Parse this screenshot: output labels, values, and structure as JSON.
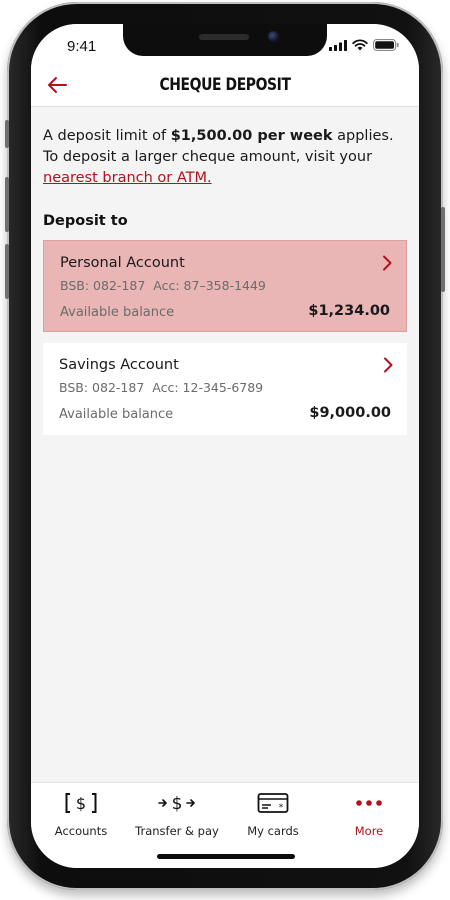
{
  "status_bar": {
    "time": "9:41"
  },
  "header": {
    "title": "CHEQUE DEPOSIT",
    "back_icon": "arrow-left-icon"
  },
  "intro": {
    "text_before": "A deposit limit of ",
    "limit_bold": "$1,500.00 per week",
    "text_after": " applies. To deposit a larger cheque amount, visit your ",
    "link_text": "nearest branch or ATM."
  },
  "deposit_to": {
    "label": "Deposit to",
    "accounts": [
      {
        "name": "Personal Account",
        "bsb": "BSB: 082-187",
        "acc": "Acc: 87–358-1449",
        "balance_label": "Available balance",
        "balance": "$1,234.00",
        "selected": true
      },
      {
        "name": "Savings Account",
        "bsb": "BSB: 082-187",
        "acc": "Acc: 12-345-6789",
        "balance_label": "Available balance",
        "balance": "$9,000.00",
        "selected": false
      }
    ]
  },
  "tab_bar": {
    "tabs": [
      {
        "label": "Accounts",
        "icon": "dollar-bracket-icon",
        "active": false
      },
      {
        "label": "Transfer & pay",
        "icon": "transfer-dollar-icon",
        "active": false
      },
      {
        "label": "My cards",
        "icon": "card-icon",
        "active": false
      },
      {
        "label": "More",
        "icon": "more-dots-icon",
        "active": true
      }
    ]
  },
  "colors": {
    "brand_red": "#b3121d",
    "selected_card_bg": "#eab5b5",
    "screen_bg": "#f4f4f4"
  }
}
